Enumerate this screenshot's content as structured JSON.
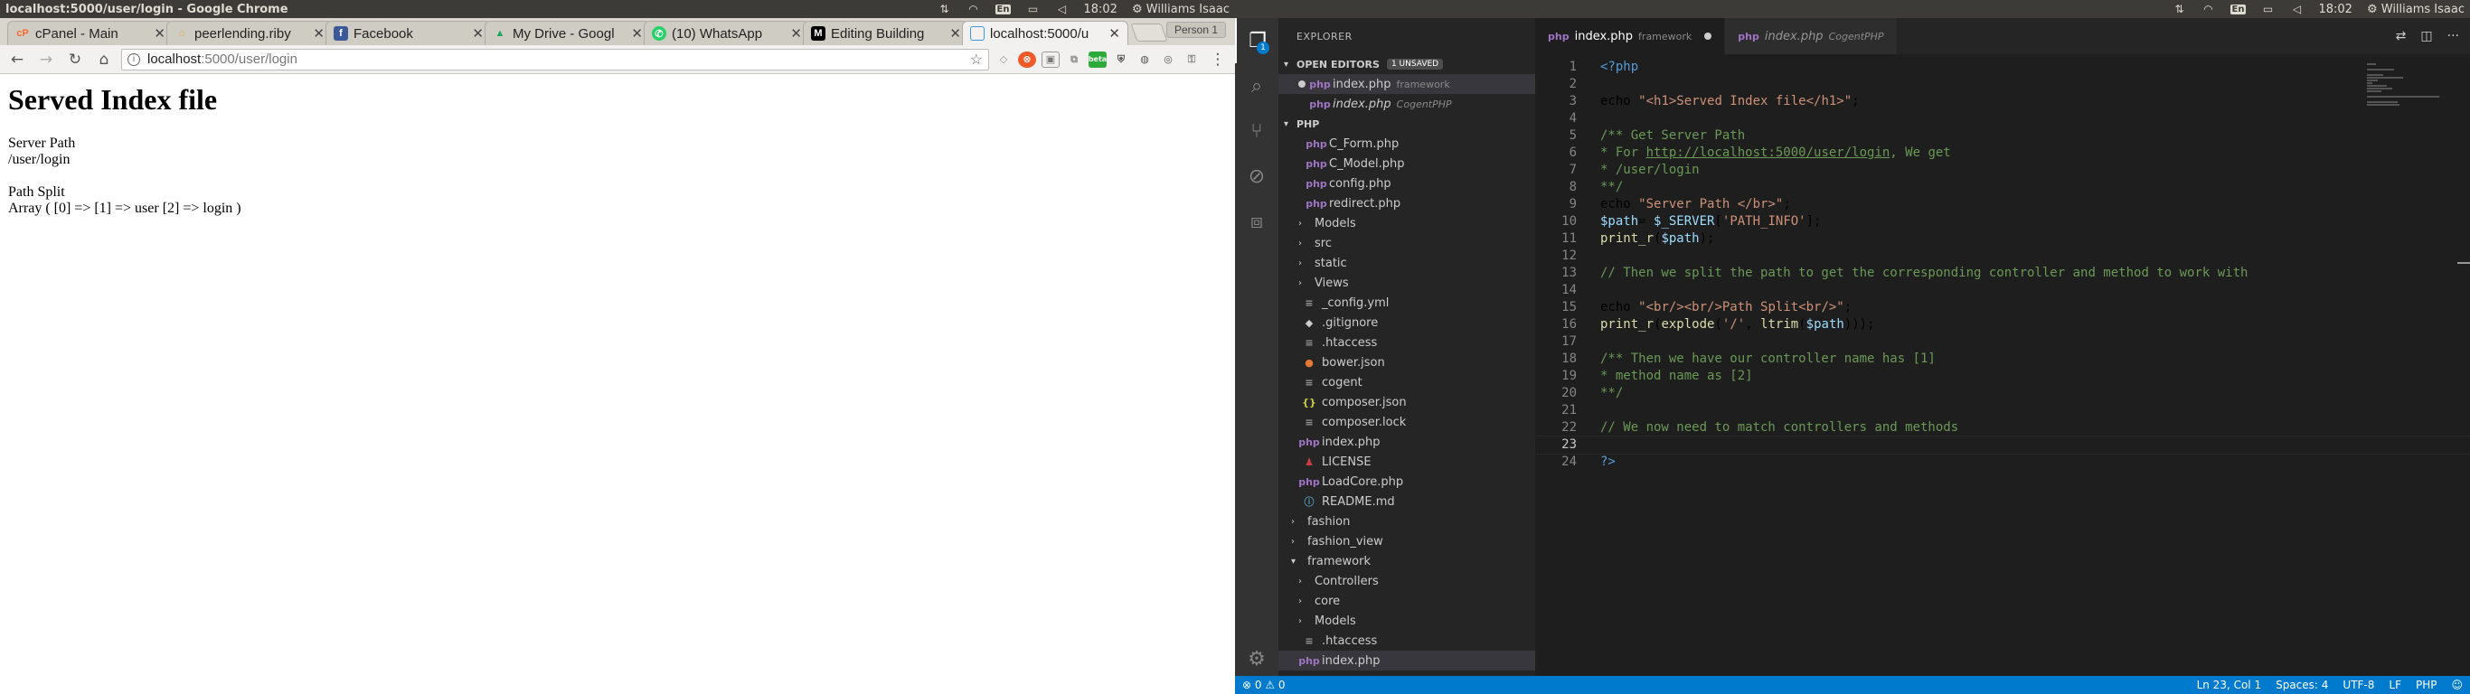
{
  "left": {
    "window_title": "localhost:5000/user/login - Google Chrome",
    "tray": {
      "lang": "En",
      "time": "18:02",
      "user": "Williams Isaac"
    },
    "tabs": [
      {
        "label": "cPanel - Main",
        "icon": "cpanel-icon",
        "color": "#ff6c2c"
      },
      {
        "label": "peerlending.riby",
        "icon": "riby-icon",
        "color": "#e8a23c"
      },
      {
        "label": "Facebook",
        "icon": "facebook-icon",
        "color": "#3b5998"
      },
      {
        "label": "My Drive - Googl",
        "icon": "google-drive-icon",
        "color": "#1fa463"
      },
      {
        "label": "(10) WhatsApp",
        "icon": "whatsapp-icon",
        "color": "#25d366"
      },
      {
        "label": "Editing Building",
        "icon": "medium-icon",
        "color": "#000000"
      },
      {
        "label": "localhost:5000/u",
        "icon": "page-icon",
        "color": "#3b9ad9"
      }
    ],
    "profile_button": "Person 1",
    "address": {
      "host": "localhost",
      "path": ":5000/user/login"
    },
    "ext_badge": "beta",
    "page": {
      "heading": "Served Index file",
      "server_path_label": "Server Path",
      "server_path_value": "/user/login",
      "path_split_label": "Path Split",
      "path_split_value": "Array ( [0] => [1] => user [2] => login )"
    }
  },
  "right": {
    "tray": {
      "lang": "En",
      "time": "18:02",
      "user": "Williams Isaac"
    },
    "explorer_title": "EXPLORER",
    "open_editors": {
      "label": "OPEN EDITORS",
      "unsaved": "1 UNSAVED"
    },
    "open_files": [
      {
        "name": "index.php",
        "desc": "framework"
      },
      {
        "name": "index.php",
        "desc": "CogentPHP"
      }
    ],
    "php_section": "PHP",
    "tree": [
      {
        "name": "C_Form.php",
        "indent": 3,
        "type": "php"
      },
      {
        "name": "C_Model.php",
        "indent": 3,
        "type": "php"
      },
      {
        "name": "config.php",
        "indent": 3,
        "type": "php"
      },
      {
        "name": "redirect.php",
        "indent": 3,
        "type": "php"
      },
      {
        "name": "Models",
        "indent": 2,
        "type": "folder"
      },
      {
        "name": "src",
        "indent": 2,
        "type": "folder"
      },
      {
        "name": "static",
        "indent": 2,
        "type": "folder"
      },
      {
        "name": "Views",
        "indent": 2,
        "type": "folder"
      },
      {
        "name": "_config.yml",
        "indent": 2,
        "type": "cfg"
      },
      {
        "name": ".gitignore",
        "indent": 2,
        "type": "git"
      },
      {
        "name": ".htaccess",
        "indent": 2,
        "type": "cfg"
      },
      {
        "name": "bower.json",
        "indent": 2,
        "type": "bower"
      },
      {
        "name": "cogent",
        "indent": 2,
        "type": "cfg"
      },
      {
        "name": "composer.json",
        "indent": 2,
        "type": "json"
      },
      {
        "name": "composer.lock",
        "indent": 2,
        "type": "cfg"
      },
      {
        "name": "index.php",
        "indent": 2,
        "type": "php"
      },
      {
        "name": "LICENSE",
        "indent": 2,
        "type": "lic"
      },
      {
        "name": "LoadCore.php",
        "indent": 2,
        "type": "php"
      },
      {
        "name": "README.md",
        "indent": 2,
        "type": "md"
      },
      {
        "name": "fashion",
        "indent": 1,
        "type": "folder"
      },
      {
        "name": "fashion_view",
        "indent": 1,
        "type": "folder"
      },
      {
        "name": "framework",
        "indent": 1,
        "type": "folder-open"
      },
      {
        "name": "Controllers",
        "indent": 2,
        "type": "folder"
      },
      {
        "name": "core",
        "indent": 2,
        "type": "folder"
      },
      {
        "name": "Models",
        "indent": 2,
        "type": "folder"
      },
      {
        "name": ".htaccess",
        "indent": 2,
        "type": "cfg"
      },
      {
        "name": "index.php",
        "indent": 2,
        "type": "php-selected"
      }
    ],
    "editor_tabs": [
      {
        "name": "index.php",
        "desc": "framework"
      },
      {
        "name": "index.php",
        "desc": "CogentPHP"
      }
    ],
    "code_lines": [
      "<?php",
      "",
      "echo \"<h1>Served Index file</h1>\";",
      "",
      "/** Get Server Path",
      "* For http://localhost:5000/user/login, We get",
      "* /user/login",
      "**/",
      "echo \"Server Path </br>\";",
      "$path= $_SERVER['PATH_INFO'];",
      "print_r($path);",
      "",
      "// Then we split the path to get the corresponding controller and method to work with",
      "",
      "echo \"<br/><br/>Path Split<br/>\";",
      "print_r(explode('/', ltrim($path)));",
      "",
      "/** Then we have our controller name has [1]",
      "* method name as [2]",
      "**/",
      "",
      "// We now need to match controllers and methods",
      "",
      "?>"
    ],
    "status": {
      "errors": "0",
      "warnings": "0",
      "cursor": "Ln 23, Col 1",
      "spaces": "Spaces: 4",
      "encoding": "UTF-8",
      "eol": "LF",
      "language": "PHP"
    }
  }
}
